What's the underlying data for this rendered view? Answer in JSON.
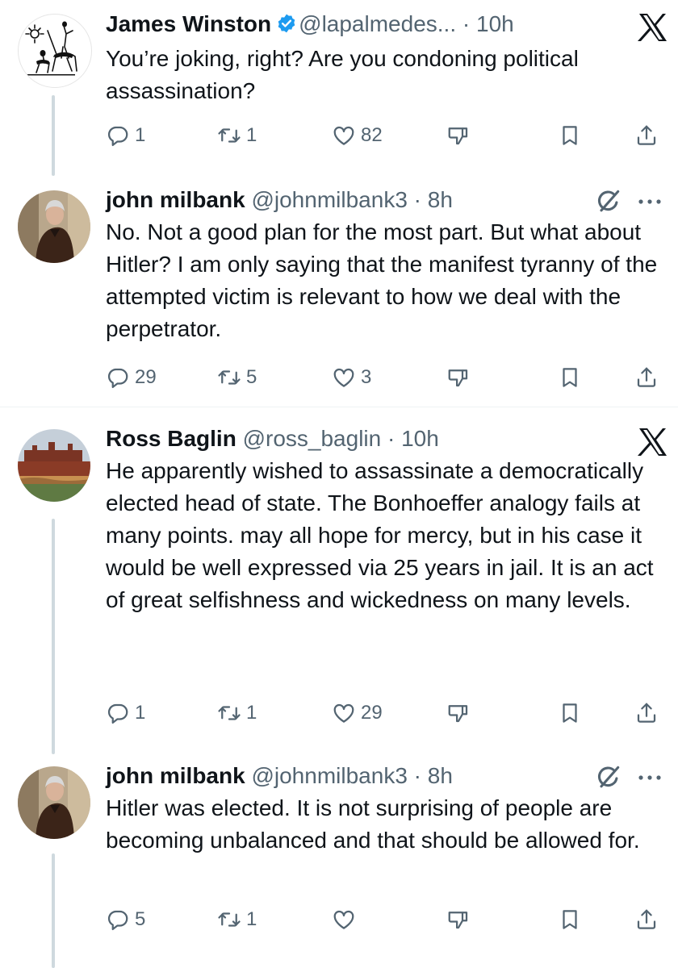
{
  "tweets": [
    {
      "name": "James Winston",
      "verified": true,
      "handle": "@lapalmedes...",
      "separator": "·",
      "time": "10h",
      "text": "You’re joking, right? Are you condoning political assassination?",
      "replies": "1",
      "reposts": "1",
      "likes": "82",
      "corner_icon": "x-logo-icon"
    },
    {
      "name": "john milbank",
      "verified": false,
      "handle": "@johnmilbank3",
      "separator": "·",
      "time": "8h",
      "text": "No. Not a good plan for the most part. But what about Hitler? I am only saying that the manifest tyranny of the attempted victim is relevant to how we deal with the perpetrator.",
      "replies": "29",
      "reposts": "5",
      "likes": "3",
      "corner_icon": "grok-icon"
    },
    {
      "name": "Ross Baglin",
      "verified": false,
      "handle": "@ross_baglin",
      "separator": "·",
      "time": "10h",
      "text": "He apparently wished to assassinate a democratically elected head of state.  The Bonhoeffer analogy fails at many points.   may all hope for mercy, but in his case it would be well expressed via 25 years in jail.  It is an act of great selfishness and wickedness on many levels.",
      "replies": "1",
      "reposts": "1",
      "likes": "29",
      "corner_icon": "x-logo-icon"
    },
    {
      "name": "john milbank",
      "verified": false,
      "handle": "@johnmilbank3",
      "separator": "·",
      "time": "8h",
      "text": "Hitler was elected. It is not surprising of people are becoming unbalanced and that should be allowed for.",
      "replies": "5",
      "reposts": "1",
      "likes": "",
      "corner_icon": "grok-icon"
    }
  ],
  "icons": {
    "reply": "reply-icon",
    "repost": "repost-icon",
    "like": "heart-icon",
    "downvote": "thumbs-down-icon",
    "bookmark": "bookmark-icon",
    "share": "share-icon",
    "more": "more-icon"
  },
  "colors": {
    "text": "#0f1419",
    "secondary": "#536471",
    "verified": "#1d9bf0",
    "thread_line": "#cfd9de"
  }
}
